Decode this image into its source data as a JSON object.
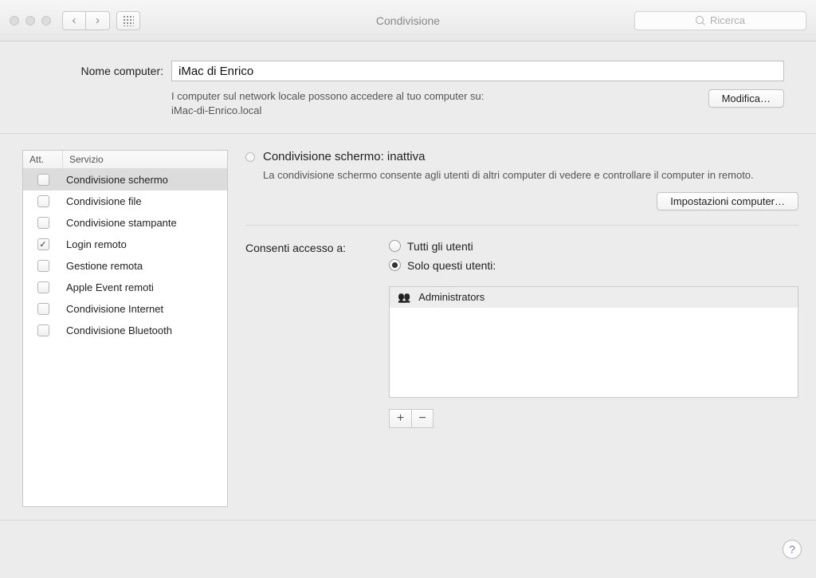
{
  "window": {
    "title": "Condivisione"
  },
  "search": {
    "placeholder": "Ricerca"
  },
  "computer_name": {
    "label": "Nome computer:",
    "value": "iMac di Enrico",
    "description_line1": "I computer sul network locale possono accedere al tuo computer su:",
    "description_line2": "iMac-di-Enrico.local",
    "edit_button": "Modifica…"
  },
  "services_table": {
    "header_active": "Att.",
    "header_service": "Servizio",
    "rows": [
      {
        "label": "Condivisione schermo",
        "checked": false,
        "selected": true
      },
      {
        "label": "Condivisione file",
        "checked": false,
        "selected": false
      },
      {
        "label": "Condivisione stampante",
        "checked": false,
        "selected": false
      },
      {
        "label": "Login remoto",
        "checked": true,
        "selected": false
      },
      {
        "label": "Gestione remota",
        "checked": false,
        "selected": false
      },
      {
        "label": "Apple Event remoti",
        "checked": false,
        "selected": false
      },
      {
        "label": "Condivisione Internet",
        "checked": false,
        "selected": false
      },
      {
        "label": "Condivisione Bluetooth",
        "checked": false,
        "selected": false
      }
    ]
  },
  "detail": {
    "status_title": "Condivisione schermo: inattiva",
    "status_desc": "La condivisione schermo consente agli utenti di altri computer di vedere e controllare il computer in remoto.",
    "computer_settings_button": "Impostazioni computer…",
    "access_label": "Consenti accesso a:",
    "radio_all": "Tutti gli utenti",
    "radio_only": "Solo questi utenti:",
    "users": [
      {
        "label": "Administrators"
      }
    ]
  },
  "help_label": "?"
}
